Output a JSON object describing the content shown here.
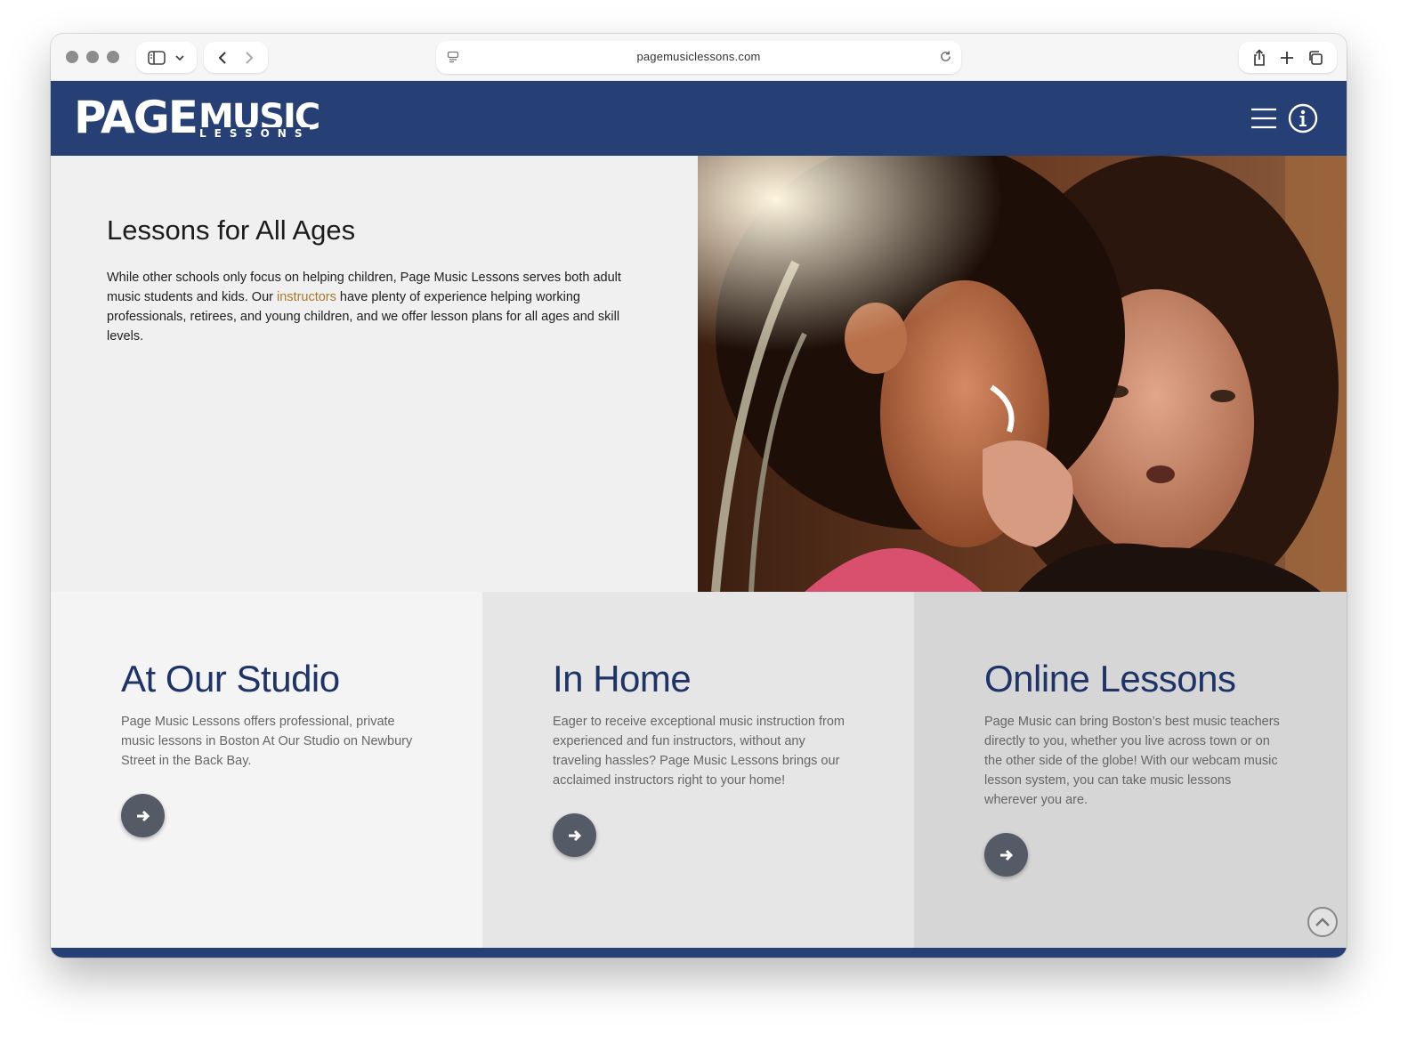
{
  "browser": {
    "url": "pagemusiclessons.com"
  },
  "header": {
    "logo_main": "PAGE",
    "logo_music": "MUSIC",
    "logo_sub": "LESSONS"
  },
  "hero": {
    "title": "Lessons for All Ages",
    "text_before": "While other schools only focus on helping children, Page Music Lessons serves both adult music students and kids. Our ",
    "link": "instructors",
    "text_after": " have plenty of experience helping working professionals, retirees, and young children, and we offer lesson plans for all ages and skill levels."
  },
  "cards": [
    {
      "title": "At Our Studio",
      "text": "Page Music Lessons offers professional, private music lessons in Boston At Our Studio on Newbury Street in the Back Bay."
    },
    {
      "title": "In Home",
      "text": "Eager to receive exceptional music instruction from experienced and fun instructors, without any traveling hassles? Page Music Lessons brings our acclaimed instructors right to your home!"
    },
    {
      "title": "Online Lessons",
      "text": "Page Music can bring Boston’s best music teachers directly to you, whether you live across town or on the other side of the globe! With our webcam music lesson system, you can take music lessons wherever you are."
    }
  ],
  "colors": {
    "brand_navy": "#263f74",
    "title_navy": "#1f3466",
    "link_gold": "#a8792c",
    "button_gray": "#555a67"
  }
}
